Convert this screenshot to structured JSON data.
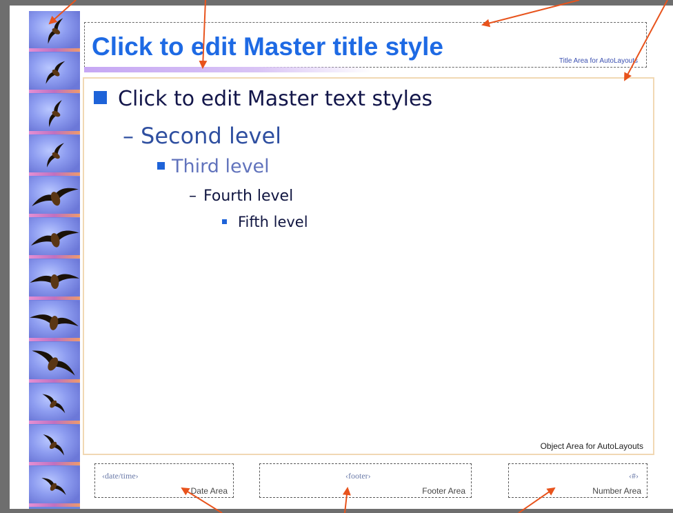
{
  "title": {
    "text": "Click to edit Master title style",
    "area_label": "Title Area for AutoLayouts"
  },
  "body": {
    "levels": [
      "Click to edit Master text styles",
      "Second level",
      "Third level",
      "Fourth level",
      "Fifth level"
    ],
    "level_markers": [
      "■",
      "–",
      "■",
      "–",
      "■"
    ],
    "area_label": "Object Area for AutoLayouts"
  },
  "footer": {
    "date_field": "‹date/time›",
    "date_label": "Date Area",
    "footer_field": "‹footer›",
    "footer_label": "Footer Area",
    "number_field": "‹#›",
    "number_label": "Number Area"
  },
  "colors": {
    "title_text": "#1e6ae4",
    "bullet": "#1e63d8",
    "arrow": "#e8531c",
    "frame": "#6e6e6e"
  },
  "icons": [
    "bird-icon",
    "arrow-annotation"
  ]
}
